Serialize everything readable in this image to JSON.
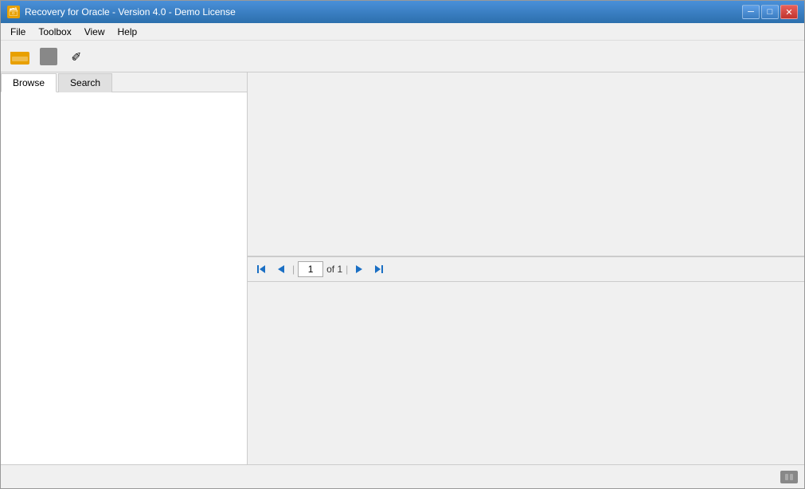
{
  "window": {
    "title": "Recovery for Oracle - Version 4.0 - Demo License",
    "icon": "🗃"
  },
  "titlebar": {
    "minimize_label": "─",
    "restore_label": "□",
    "close_label": "✕"
  },
  "menubar": {
    "items": [
      {
        "label": "File",
        "id": "file"
      },
      {
        "label": "Toolbox",
        "id": "toolbox"
      },
      {
        "label": "View",
        "id": "view"
      },
      {
        "label": "Help",
        "id": "help"
      }
    ]
  },
  "toolbar": {
    "open_label": "open",
    "stop_label": "stop",
    "pencil_label": "edit"
  },
  "tabs": {
    "browse": "Browse",
    "search": "Search"
  },
  "pagination": {
    "current_page": "1",
    "of_label": "of 1",
    "separator": "|"
  },
  "status": {
    "icon_label": "status"
  }
}
